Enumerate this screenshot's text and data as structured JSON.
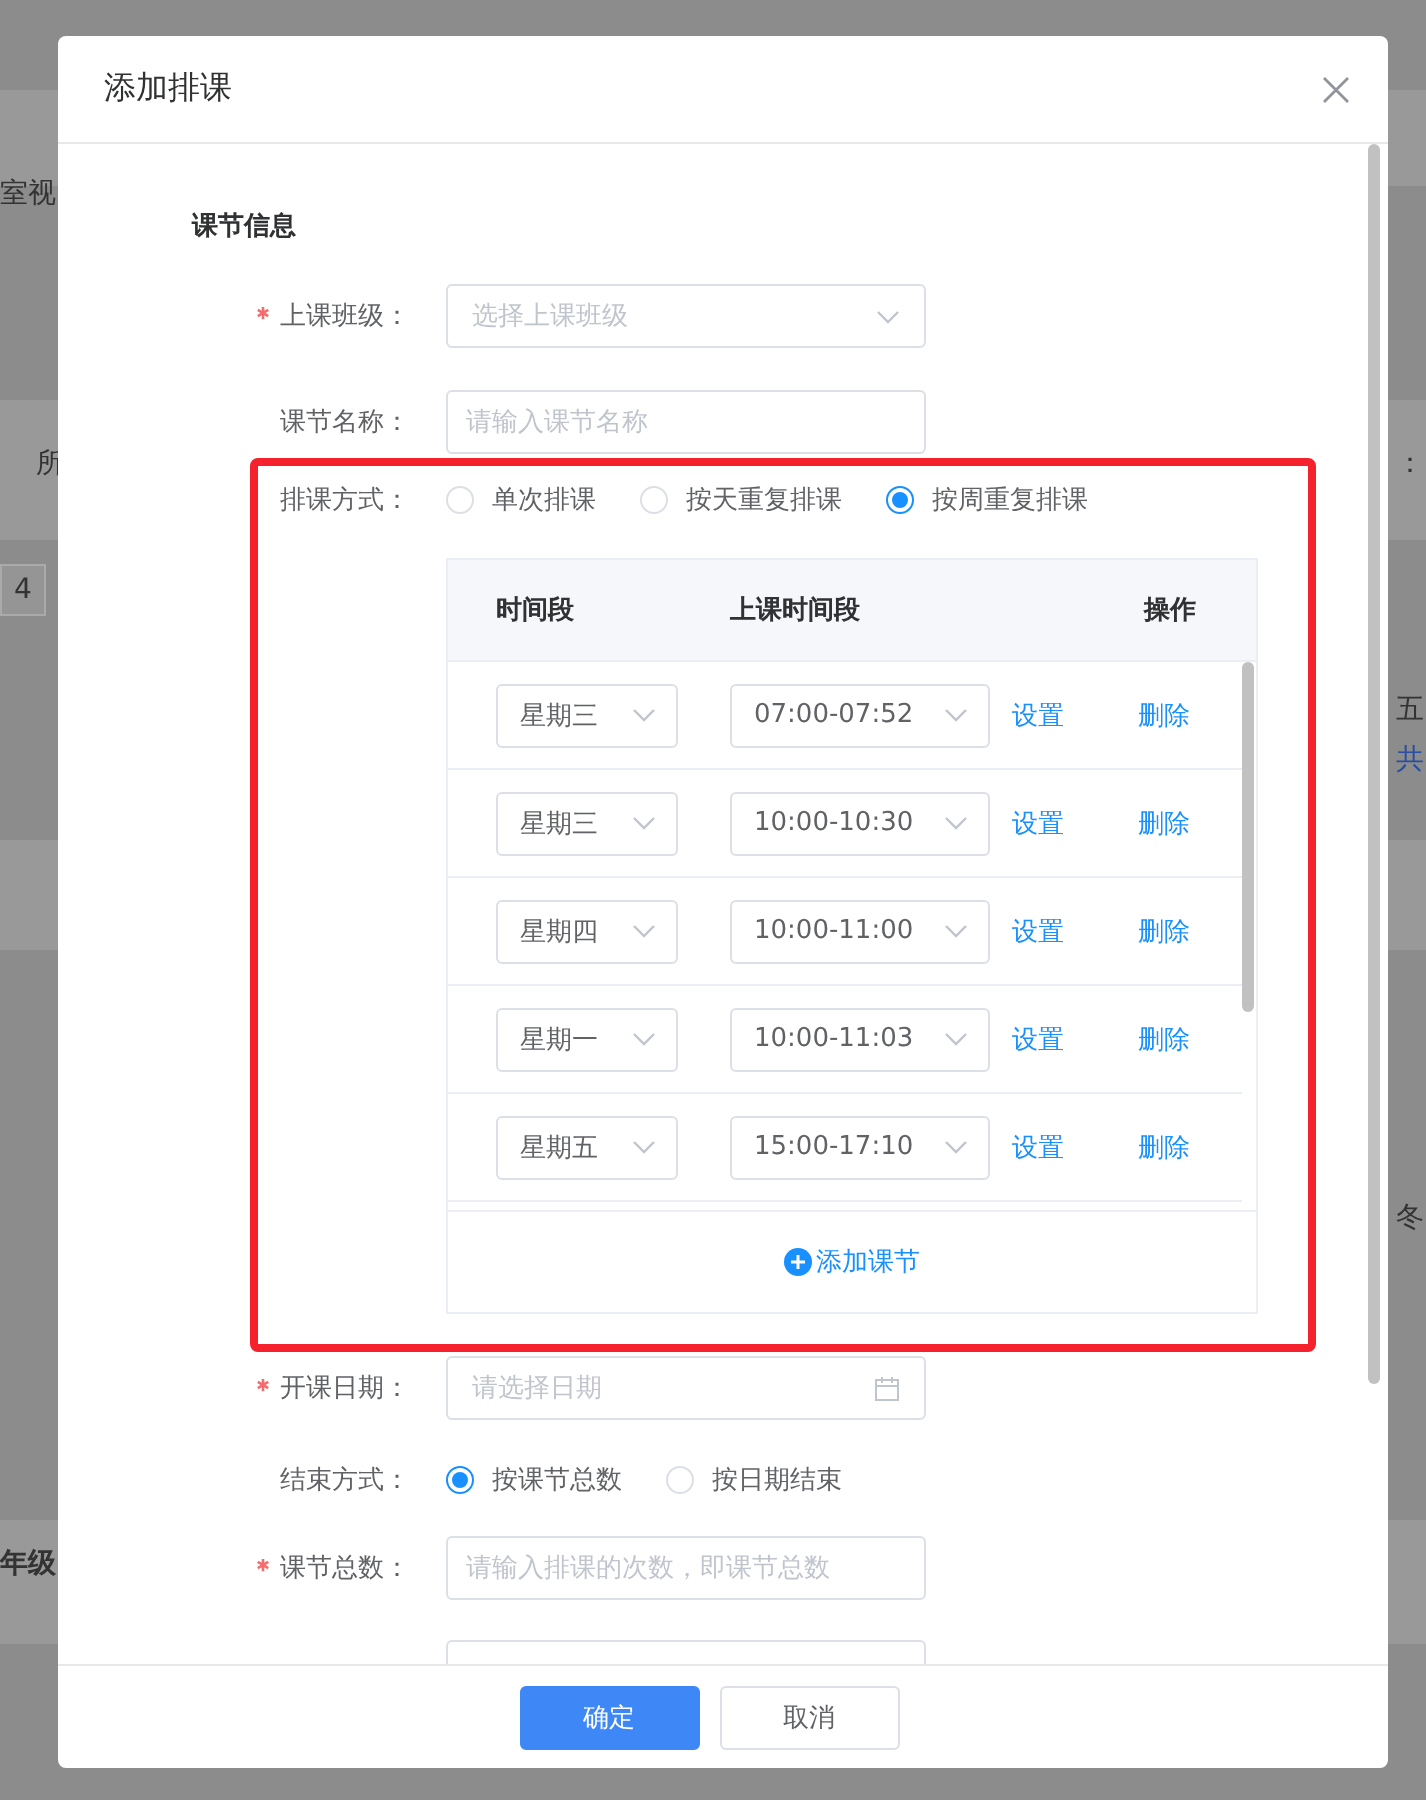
{
  "background": {
    "fragments": [
      {
        "text": "室视",
        "kind": "text"
      },
      {
        "text": "所",
        "kind": "text"
      },
      {
        "text": "4",
        "kind": "box"
      },
      {
        "text": "年级",
        "kind": "bold"
      },
      {
        "text": "：",
        "kind": "text"
      },
      {
        "text": "五",
        "kind": "text"
      },
      {
        "text": "共",
        "kind": "link"
      },
      {
        "text": "冬",
        "kind": "text"
      }
    ]
  },
  "dialog": {
    "title": "添加排课",
    "section_title": "课节信息",
    "fields": [
      {
        "kind": "select",
        "label": "上课班级：",
        "required": true,
        "placeholder": "选择上课班级"
      },
      {
        "kind": "input",
        "label": "课节名称：",
        "required": false,
        "placeholder": "请输入课节名称"
      }
    ],
    "schedule_mode": {
      "label": "排课方式：",
      "options": [
        {
          "label": "单次排课",
          "selected": false
        },
        {
          "label": "按天重复排课",
          "selected": false
        },
        {
          "label": "按周重复排课",
          "selected": true
        }
      ]
    },
    "slots_table": {
      "columns": [
        "时间段",
        "上课时间段",
        "操作"
      ],
      "rows": [
        {
          "weekday": "星期三",
          "time": "07:00-07:52",
          "actions": [
            "设置",
            "删除"
          ]
        },
        {
          "weekday": "星期三",
          "time": "10:00-10:30",
          "actions": [
            "设置",
            "删除"
          ]
        },
        {
          "weekday": "星期四",
          "time": "10:00-11:00",
          "actions": [
            "设置",
            "删除"
          ]
        },
        {
          "weekday": "星期一",
          "time": "10:00-11:03",
          "actions": [
            "设置",
            "删除"
          ]
        },
        {
          "weekday": "星期五",
          "time": "15:00-17:10",
          "actions": [
            "设置",
            "删除"
          ]
        }
      ],
      "add_button": "添加课节"
    },
    "lower_fields": [
      {
        "kind": "date",
        "label": "开课日期：",
        "required": true,
        "placeholder": "请选择日期"
      },
      {
        "kind": "radio",
        "label": "结束方式：",
        "required": false,
        "options": [
          {
            "label": "按课节总数",
            "selected": true
          },
          {
            "label": "按日期结束",
            "selected": false
          }
        ]
      },
      {
        "kind": "input",
        "label": "课节总数：",
        "required": true,
        "placeholder": "请输入排课的次数，即课节总数"
      }
    ],
    "buttons": [
      {
        "label": "确定",
        "kind": "primary"
      },
      {
        "label": "取消",
        "kind": "default"
      }
    ]
  }
}
